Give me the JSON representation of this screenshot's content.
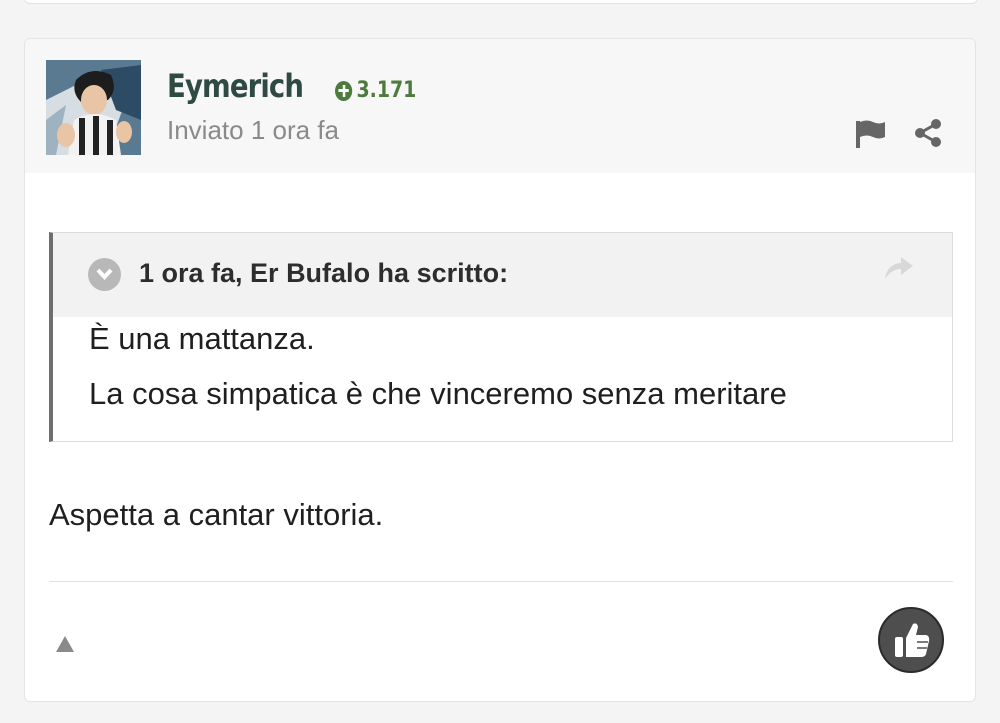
{
  "post": {
    "author": "Eymerich",
    "reputation": "3.171",
    "posted": "Inviato 1 ora fa",
    "quote": {
      "citation": "1 ora fa, Er Bufalo ha scritto:",
      "lines": [
        "È una mattanza.",
        "La cosa simpatica è che vinceremo senza meritare"
      ]
    },
    "body": "Aspetta a cantar vittoria."
  },
  "icons": {
    "reputation": "plus-circle-icon",
    "report": "flag-icon",
    "share": "share-icon",
    "quote_toggle": "chevron-down-icon",
    "goto_quote": "reply-arrow-icon",
    "scroll_top": "triangle-up-icon",
    "like": "thumbs-up-icon"
  },
  "colors": {
    "author": "#2f4a43",
    "reputation": "#4d7b3c",
    "like_button": "#4e4e4e"
  }
}
